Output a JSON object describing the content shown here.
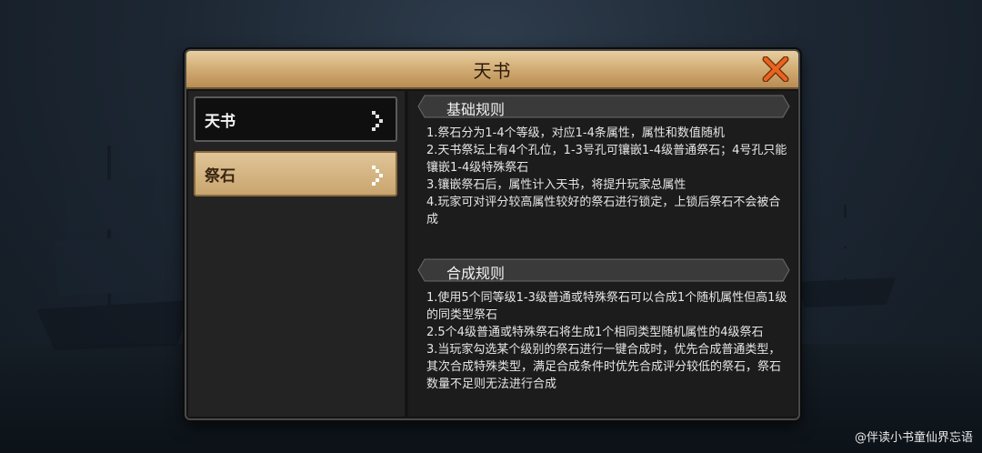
{
  "colors": {
    "title_bar": "#cfa96f",
    "dialog_bg": "#141414",
    "active_tab": "#d8bb88",
    "close_x": "#e05a1c"
  },
  "dialog": {
    "title": "天书",
    "close_icon": "close-x-icon"
  },
  "nav": {
    "items": [
      {
        "label": "天书",
        "state": "inactive"
      },
      {
        "label": "祭石",
        "state": "active"
      }
    ]
  },
  "sections": [
    {
      "title": "基础规则",
      "rules": [
        "1.祭石分为1-4个等级，对应1-4条属性，属性和数值随机",
        "2.天书祭坛上有4个孔位，1-3号孔可镶嵌1-4级普通祭石；4号孔只能镶嵌1-4级特殊祭石",
        "3.镶嵌祭石后，属性计入天书，将提升玩家总属性",
        "4.玩家可对评分较高属性较好的祭石进行锁定，上锁后祭石不会被合成"
      ]
    },
    {
      "title": "合成规则",
      "rules": [
        "1.使用5个同等级1-3级普通或特殊祭石可以合成1个随机属性但高1级的同类型祭石",
        "2.5个4级普通或特殊祭石将生成1个相同类型随机属性的4级祭石",
        "3.当玩家勾选某个级别的祭石进行一键合成时，优先合成普通类型，其次合成特殊类型，满足合成条件时优先合成评分较低的祭石，祭石数量不足则无法进行合成"
      ]
    }
  ],
  "watermark": "@伴读小书童仙界忘语"
}
